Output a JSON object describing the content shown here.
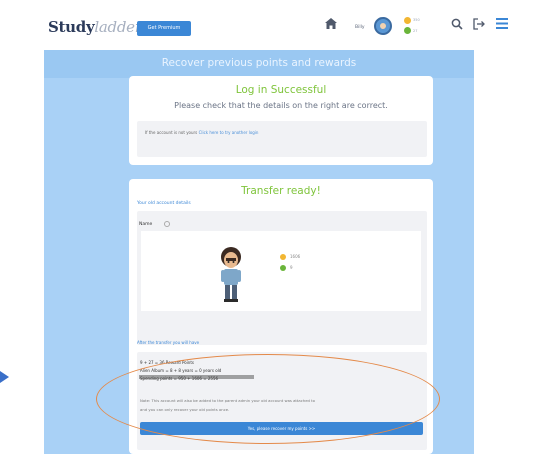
{
  "header": {
    "logo_main": "Study",
    "logo_accent": "ladder",
    "premium_label": "Get Premium",
    "username": "Billy",
    "gold_count": "350",
    "green_count": "27",
    "icons": [
      "home-icon",
      "search-icon",
      "logout-icon",
      "menu-icon"
    ]
  },
  "page": {
    "banner": "Recover previous points and rewards"
  },
  "login_card": {
    "title": "Log in Successful",
    "subtitle": "Please check that the details on the right are correct.",
    "notice_prefix": "If the account is not yours",
    "notice_link": "Click here to try another login"
  },
  "transfer_card": {
    "title": "Transfer ready!",
    "old_account_label": "Your old account details",
    "name_label": "Name",
    "stat_gold": "1606",
    "stat_green": "9",
    "after_transfer_label": "After the transfer you will have",
    "line_reward": "9 + 27 = 36 Reward Points",
    "line_album": "Alien Album = 8 + 8 years = 0 years old",
    "line_points": "Spending points = 950 + 1606 = 2556",
    "note_line1": "Note: This account will also be added to the parent admin your old account was attached to",
    "note_line2": "and you can only recover your old points once.",
    "confirm_button": "Yes, please recover my points >>"
  },
  "colors": {
    "accent_blue": "#3b87d6",
    "success_green": "#7fc43b",
    "page_blue": "#a9d1f6",
    "annotation_orange": "#e48a4a"
  }
}
